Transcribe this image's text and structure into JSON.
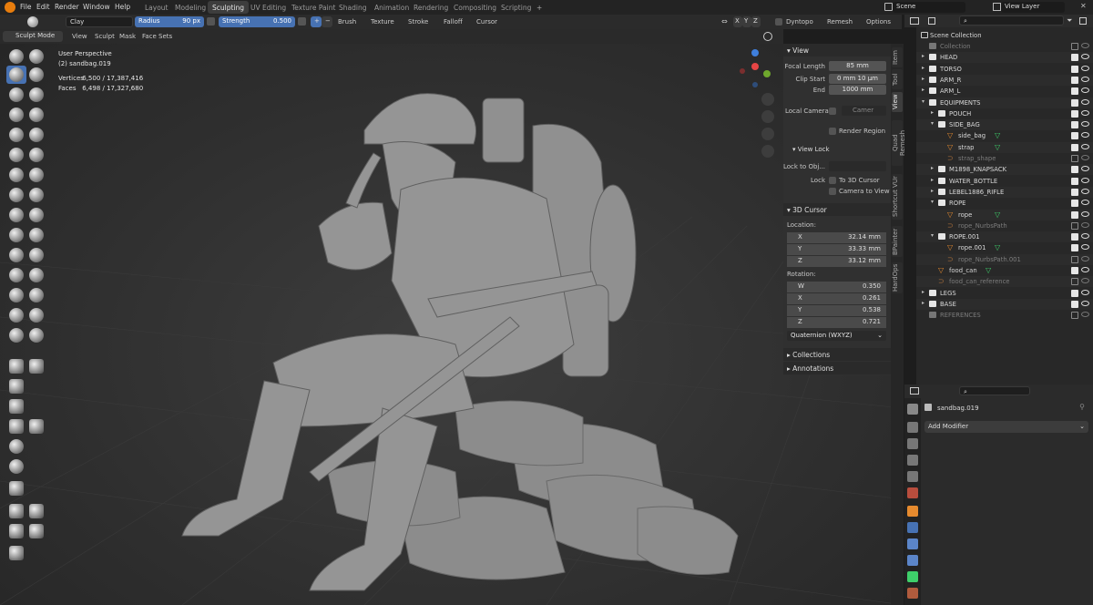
{
  "menu": {
    "items": [
      "File",
      "Edit",
      "Render",
      "Window",
      "Help"
    ]
  },
  "workspaces": [
    "Layout",
    "Modeling",
    "Sculpting",
    "UV Editing",
    "Texture Paint",
    "Shading",
    "Animation",
    "Rendering",
    "Compositing",
    "Scripting"
  ],
  "active_workspace": "Sculpting",
  "scene": {
    "name": "Scene",
    "view_layer": "View Layer"
  },
  "tool_settings": {
    "brush_name": "Clay",
    "radius_label": "Radius",
    "radius_value": "90 px",
    "strength_label": "Strength",
    "strength_value": "0.500",
    "minus": "−",
    "plus": "+",
    "menus": [
      "Brush",
      "Texture",
      "Stroke",
      "Falloff",
      "Cursor"
    ],
    "axes": [
      "X",
      "Y",
      "Z"
    ],
    "dyntopo": "Dyntopo",
    "remesh": "Remesh",
    "options": "Options"
  },
  "header": {
    "mode": "Sculpt Mode",
    "menus": [
      "View",
      "Sculpt",
      "Mask",
      "Face Sets"
    ]
  },
  "overlay_info": {
    "perspective": "User Perspective",
    "object": "(2) sandbag.019",
    "vertices_label": "Vertices",
    "vertices_value": "6,500 / 17,387,416",
    "faces_label": "Faces",
    "faces_value": "6,498 / 17,327,680"
  },
  "npanel": {
    "tabs": [
      "Item",
      "Tool",
      "View",
      "Quad Remesh",
      "Shortcut VUr",
      "BPainter",
      "HardOps"
    ],
    "active_tab": "View",
    "view": {
      "title": "View",
      "focal_length_label": "Focal Length",
      "focal_length": "85 mm",
      "clip_start_label": "Clip Start",
      "clip_start": "0 mm 10 µm",
      "end_label": "End",
      "end": "1000 mm",
      "local_camera_label": "Local Camera",
      "camera_placeholder": "Camer",
      "render_region": "Render Region",
      "view_lock_title": "View Lock",
      "lock_to_obj_label": "Lock to Obj...",
      "lock_label": "Lock",
      "to_3d_cursor": "To 3D Cursor",
      "camera_to_view": "Camera to View"
    },
    "cursor": {
      "title": "3D Cursor",
      "location_label": "Location:",
      "x_label": "X",
      "x": "32.14 mm",
      "y_label": "Y",
      "y": "33.33 mm",
      "z_label": "Z",
      "z": "33.12 mm",
      "rotation_label": "Rotation:",
      "w_label": "W",
      "w": "0.350",
      "rx_label": "X",
      "rx": "0.261",
      "ry_label": "Y",
      "ry": "0.538",
      "rz_label": "Z",
      "rz": "0.721",
      "mode": "Quaternion (WXYZ)"
    },
    "collections": "Collections",
    "annotations": "Annotations"
  },
  "outliner": {
    "root": "Scene Collection",
    "rows": [
      {
        "label": "Collection",
        "kind": "collection",
        "indent": 0,
        "muted": true
      },
      {
        "label": "HEAD",
        "kind": "collection",
        "indent": 0
      },
      {
        "label": "TORSO",
        "kind": "collection",
        "indent": 0
      },
      {
        "label": "ARM_R",
        "kind": "collection",
        "indent": 0
      },
      {
        "label": "ARM_L",
        "kind": "collection",
        "indent": 0
      },
      {
        "label": "EQUIPMENTS",
        "kind": "collection",
        "indent": 0
      },
      {
        "label": "POUCH",
        "kind": "collection",
        "indent": 1
      },
      {
        "label": "SIDE_BAG",
        "kind": "collection",
        "indent": 1
      },
      {
        "label": "side_bag",
        "kind": "mesh",
        "indent": 2
      },
      {
        "label": "strap",
        "kind": "mesh",
        "indent": 2
      },
      {
        "label": "strap_shape",
        "kind": "curve",
        "indent": 2,
        "muted": true
      },
      {
        "label": "M1898_KNAPSACK",
        "kind": "collection",
        "indent": 1
      },
      {
        "label": "WATER_BOTTLE",
        "kind": "collection",
        "indent": 1
      },
      {
        "label": "LEBEL1886_RIFLE",
        "kind": "collection",
        "indent": 1
      },
      {
        "label": "ROPE",
        "kind": "collection",
        "indent": 1
      },
      {
        "label": "rope",
        "kind": "mesh",
        "indent": 2
      },
      {
        "label": "rope_NurbsPath",
        "kind": "curve",
        "indent": 2,
        "muted": true
      },
      {
        "label": "ROPE.001",
        "kind": "collection",
        "indent": 1
      },
      {
        "label": "rope.001",
        "kind": "mesh",
        "indent": 2
      },
      {
        "label": "rope_NurbsPath.001",
        "kind": "curve",
        "indent": 2,
        "muted": true
      },
      {
        "label": "food_can",
        "kind": "mesh",
        "indent": 1
      },
      {
        "label": "food_can_reference",
        "kind": "curve",
        "indent": 1,
        "muted": true
      },
      {
        "label": "LEGS",
        "kind": "collection",
        "indent": 0
      },
      {
        "label": "BASE",
        "kind": "collection",
        "indent": 0
      },
      {
        "label": "REFERENCES",
        "kind": "collection",
        "indent": 0,
        "muted": true
      }
    ]
  },
  "properties": {
    "object_name": "sandbag.019",
    "add_modifier": "Add Modifier"
  }
}
